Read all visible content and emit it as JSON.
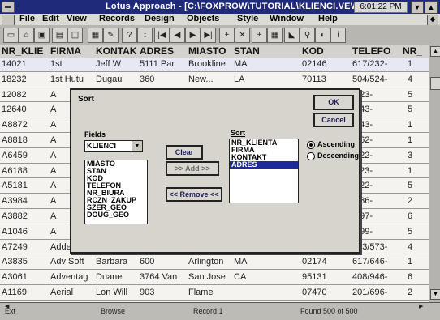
{
  "window": {
    "title": "Lotus Approach - [C:\\FOXPROW\\TUTORIAL\\KLIENCI.VEW:Li",
    "clock": "6:01:22 PM"
  },
  "menu": [
    "File",
    "Edit",
    "View",
    "Records",
    "Design",
    "Objects",
    "Style",
    "Window",
    "Help"
  ],
  "table": {
    "columns": [
      "NR_KLIE",
      "FIRMA",
      "KONTAK",
      "ADRES",
      "MIASTO",
      "STAN",
      "KOD",
      "TELEFO",
      "NR_"
    ],
    "rows": [
      [
        "14021",
        "1st",
        "Jeff W",
        "5111 Par",
        "Brookline",
        "MA",
        "02146",
        "617/232-",
        "1"
      ],
      [
        "18232",
        "1st Hutu",
        "Dugau",
        "360",
        "New...",
        "LA",
        "70113",
        "504/524-",
        "4"
      ],
      [
        "12082",
        "A",
        "",
        "",
        "",
        "",
        "",
        "/723-",
        "5"
      ],
      [
        "12640",
        "A",
        "",
        "",
        "",
        "",
        "",
        "/243-",
        "5"
      ],
      [
        "A8872",
        "A",
        "",
        "",
        "",
        "",
        "",
        "/643-",
        "1"
      ],
      [
        "A8818",
        "A",
        "",
        "",
        "",
        "",
        "",
        "/662-",
        "1"
      ],
      [
        "A6459",
        "A",
        "",
        "",
        "",
        "",
        "",
        "/222-",
        "3"
      ],
      [
        "A6188",
        "A",
        "",
        "",
        "",
        "",
        "",
        "/823-",
        "1"
      ],
      [
        "A5181",
        "A",
        "",
        "",
        "",
        "",
        "",
        "/622-",
        "5"
      ],
      [
        "A3984",
        "A",
        "",
        "",
        "",
        "",
        "",
        "/786-",
        "2"
      ],
      [
        "A3882",
        "A",
        "",
        "",
        "",
        "",
        "",
        "/897-",
        "6"
      ],
      [
        "A1046",
        "A",
        "",
        "",
        "",
        "",
        "",
        "/499-",
        "5"
      ],
      [
        "A7249",
        "Adder",
        "Brenda",
        "1237 Ber",
        "Warren",
        "MI",
        "48093",
        "313/573-",
        "4"
      ],
      [
        "A3835",
        "Adv Soft",
        "Barbara",
        "600",
        "Arlington",
        "MA",
        "02174",
        "617/646-",
        "1"
      ],
      [
        "A3061",
        "Adventag",
        "Duane",
        "3764 Van",
        "San Jose",
        "CA",
        "95131",
        "408/946-",
        "6"
      ],
      [
        "A1169",
        "Aerial",
        "Lon Will",
        "903",
        "Flame",
        "",
        "07470",
        "201/696-",
        "2"
      ]
    ]
  },
  "status": {
    "left": "Ext",
    "mode": "Browse",
    "form": "Record 1",
    "found": "Found 500 of 500"
  },
  "dialog": {
    "title": "Sort",
    "ok": "OK",
    "cancel": "Cancel",
    "fields_label": "Fields",
    "db_select": "KLIENCI",
    "fields": [
      "MIASTO",
      "STAN",
      "KOD",
      "TELEFON",
      "NR_BIURA",
      "RCZN_ZAKUP",
      "SZER_GEO",
      "DOUG_GEO"
    ],
    "clear": "Clear",
    "add": ">> Add >>",
    "remove": "<< Remove <<",
    "sort_label": "Sort",
    "sort_fields": [
      "NR_KLIENTA",
      "FIRMA",
      "KONTAKT",
      "ADRES"
    ],
    "ascending": "Ascending",
    "descending": "Descending"
  }
}
